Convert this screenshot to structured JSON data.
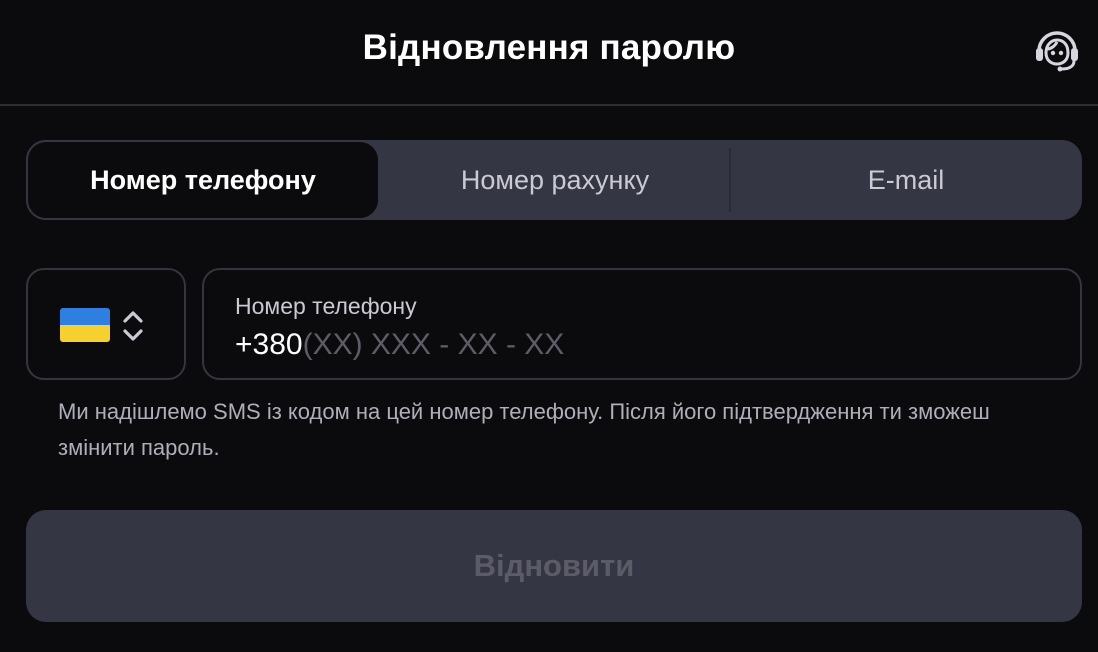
{
  "header": {
    "title": "Відновлення паролю",
    "support_icon": "headset-icon"
  },
  "tabs": [
    {
      "label": "Номер телефону",
      "active": true
    },
    {
      "label": "Номер рахунку",
      "active": false
    },
    {
      "label": "E-mail",
      "active": false
    }
  ],
  "country_select": {
    "flag_icon": "ukraine-flag-icon",
    "chevron_icon": "chevron-up-down-icon"
  },
  "phone_field": {
    "label": "Номер телефону",
    "prefix": "+380",
    "mask": "(XX) XXX - XX - XX"
  },
  "hint": "Ми надішлемо SMS із кодом на цей номер телефону. Після його підтвердження ти зможеш змінити пароль.",
  "submit": {
    "label": "Відновити",
    "disabled": true
  },
  "colors": {
    "background": "#0b0b0d",
    "surface": "#353643",
    "border": "#34353e",
    "flag_blue": "#2f7fe0",
    "flag_yellow": "#f6d02f"
  }
}
